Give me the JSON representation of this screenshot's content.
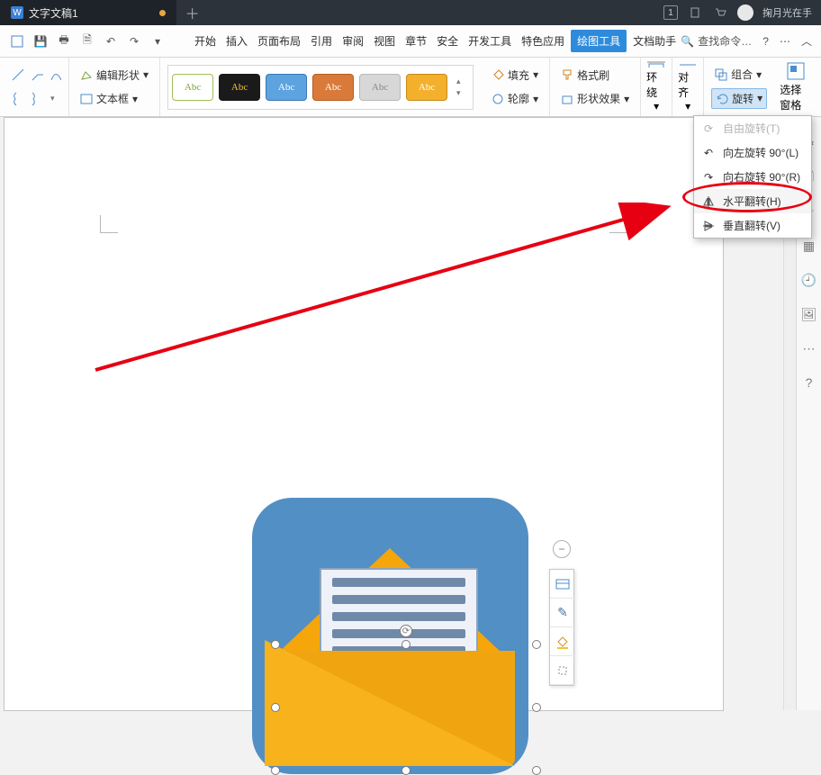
{
  "titlebar": {
    "doc_name": "文字文稿1",
    "counter": "1",
    "username": "掬月光在手"
  },
  "menubar": {
    "tabs": [
      "开始",
      "插入",
      "页面布局",
      "引用",
      "审阅",
      "视图",
      "章节",
      "安全",
      "开发工具",
      "特色应用",
      "绘图工具",
      "文档助手"
    ],
    "active_index": 10,
    "search_label": "查找命令…"
  },
  "ribbon": {
    "edit_shape": "编辑形状",
    "textbox": "文本框",
    "chip": "Abc",
    "fill": "填充",
    "outline": "轮廓",
    "format_painter": "格式刷",
    "shape_effect": "形状效果",
    "wrap": "环绕",
    "align": "对齐",
    "group": "组合",
    "rotate": "旋转",
    "select_pane": "选择窗格"
  },
  "rotate_menu": {
    "free": "自由旋转(T)",
    "left90": "向左旋转 90°(L)",
    "right90": "向右旋转 90°(R)",
    "fliph": "水平翻转(H)",
    "flipv": "垂直翻转(V)"
  }
}
